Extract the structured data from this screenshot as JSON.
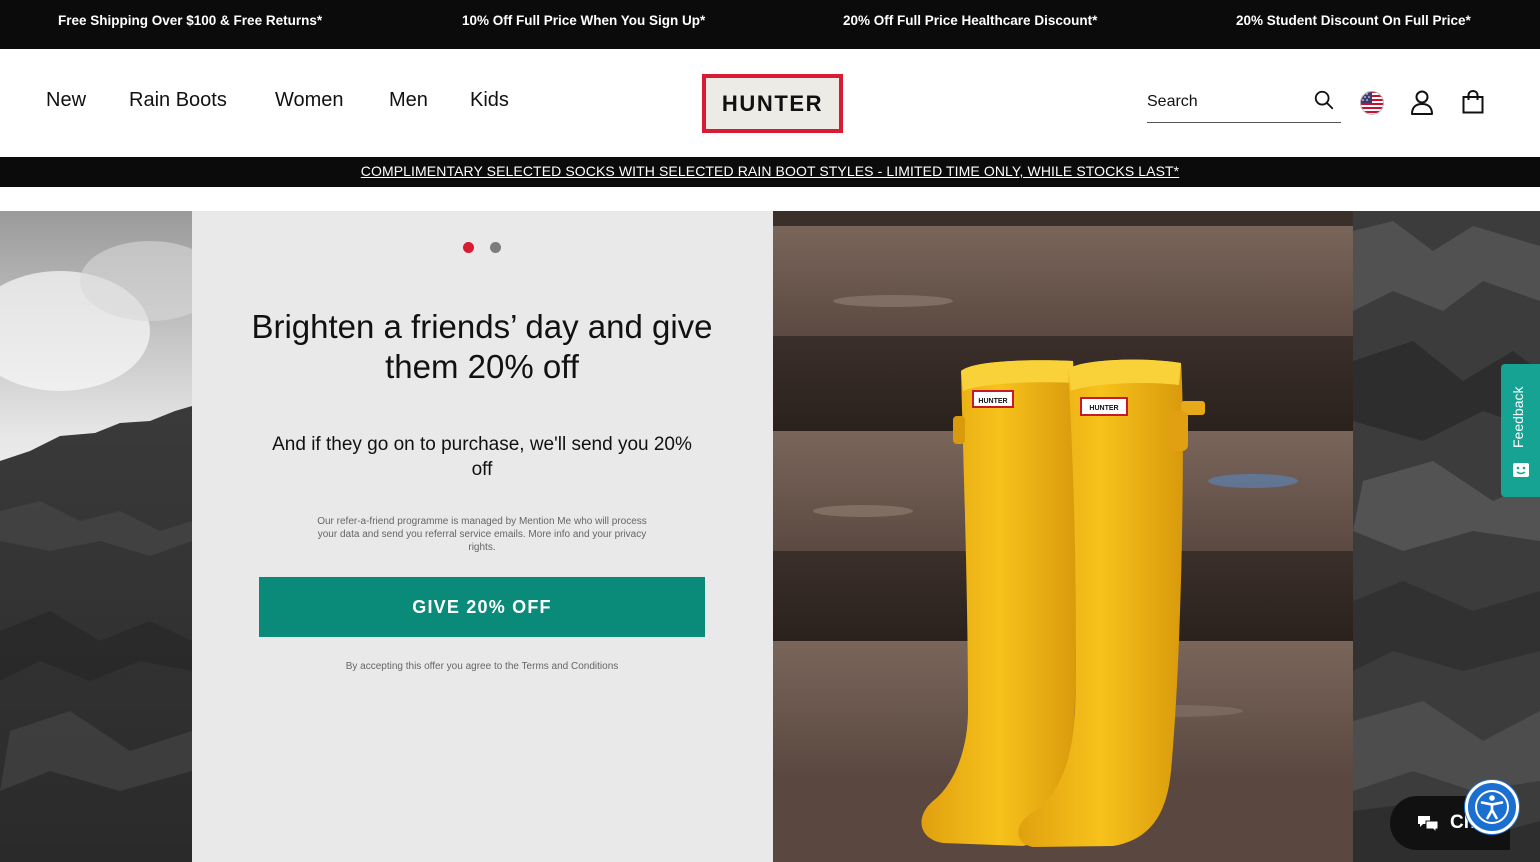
{
  "promo": {
    "items": [
      "Free Shipping Over $100 & Free Returns*",
      "10% Off Full Price When You Sign Up*",
      "20% Off Full Price Healthcare Discount*",
      "20% Student Discount On Full Price*"
    ]
  },
  "header": {
    "nav": [
      "New",
      "Rain Boots",
      "Women",
      "Men",
      "Kids"
    ],
    "logo_text": "HUNTER",
    "search_placeholder": "Search"
  },
  "announcement": {
    "text": "COMPLIMENTARY SELECTED SOCKS WITH SELECTED RAIN BOOT STYLES - LIMITED TIME ONLY, WHILE STOCKS LAST*"
  },
  "boots": {
    "label_text": "HUNTER"
  },
  "referral": {
    "slide_count": 2,
    "active_slide": 1,
    "title": "Brighten a friends’ day and give them 20% off",
    "subtitle": "And if they go on to purchase, we'll send you 20% off",
    "fine_print": "Our refer-a-friend programme is managed by Mention Me who will process your data and send you referral service emails. More info and your privacy rights.",
    "button_label": "GIVE 20% OFF",
    "terms": "By accepting this offer you agree to the Terms and Conditions"
  },
  "feedback": {
    "label": "Feedback"
  },
  "chat": {
    "label": "Ch"
  },
  "colors": {
    "brand_red": "#d71c33",
    "button_green": "#0a8a78",
    "feedback_teal": "#17a394",
    "accessibility_blue": "#1a6fd1"
  },
  "icons": [
    "search-icon",
    "us-flag-icon",
    "account-icon",
    "shopping-bag-icon",
    "feedback-smiley-icon",
    "chat-bubbles-icon",
    "accessibility-icon"
  ]
}
